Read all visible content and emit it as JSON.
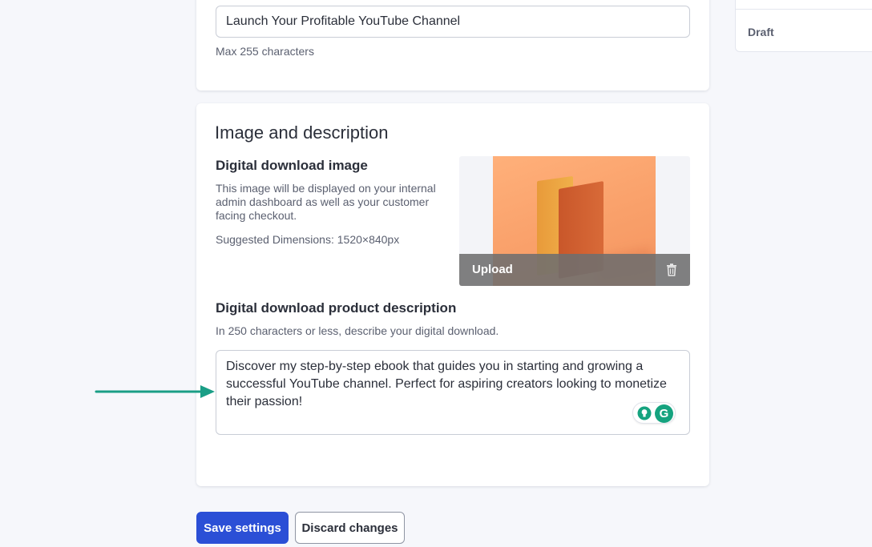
{
  "product": {
    "title_value": "Launch Your Profitable YouTube Channel",
    "title_hint": "Max 255 characters"
  },
  "sidebar": {
    "status": "Draft"
  },
  "image_section": {
    "heading": "Image and description",
    "image_label": "Digital download image",
    "image_help": "This image will be displayed on your internal admin dashboard as well as your customer facing checkout.",
    "image_dimensions": "Suggested Dimensions: 1520×840px",
    "upload_label": "Upload",
    "description_label": "Digital download product description",
    "description_help": "In 250 characters or less, describe your digital download.",
    "description_value": "Discover my step-by-step ebook that guides you in starting and growing a successful YouTube channel. Perfect for aspiring creators looking to monetize their passion!"
  },
  "grammarly": {
    "logo_letter": "G"
  },
  "actions": {
    "save_label": "Save settings",
    "discard_label": "Discard changes"
  },
  "colors": {
    "primary": "#2b4fd6",
    "arrow": "#1a9e86",
    "grammarly": "#15a37f"
  },
  "icons": [
    "trash-icon",
    "bulb-icon",
    "grammarly-icon",
    "arrow-icon"
  ]
}
